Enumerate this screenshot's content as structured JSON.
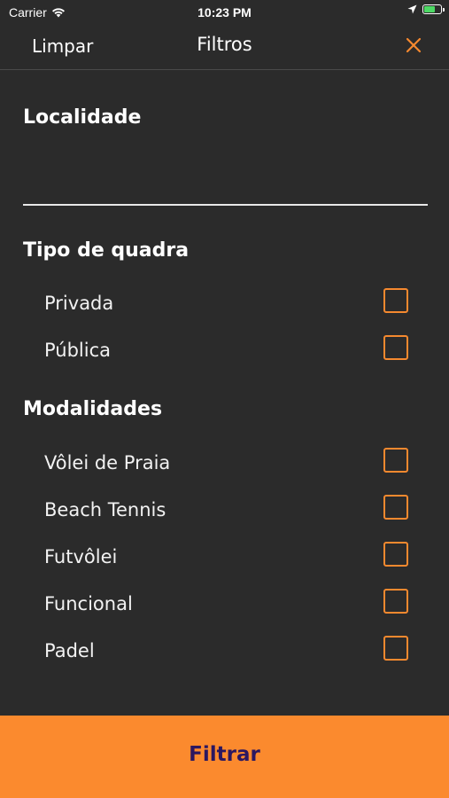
{
  "status_bar": {
    "carrier": "Carrier",
    "time": "10:23 PM"
  },
  "nav": {
    "left_label": "Limpar",
    "title": "Filtros",
    "close_icon": "close-icon",
    "accent_color": "#f5892f"
  },
  "location": {
    "title": "Localidade",
    "value": ""
  },
  "court_type": {
    "title": "Tipo de quadra",
    "options": [
      {
        "label": "Privada",
        "checked": false
      },
      {
        "label": "Pública",
        "checked": false
      }
    ]
  },
  "modalities": {
    "title": "Modalidades",
    "options": [
      {
        "label": "Vôlei de Praia",
        "checked": false
      },
      {
        "label": "Beach Tennis",
        "checked": false
      },
      {
        "label": "Futvôlei",
        "checked": false
      },
      {
        "label": "Funcional",
        "checked": false
      },
      {
        "label": "Padel",
        "checked": false
      }
    ]
  },
  "footer": {
    "button_label": "Filtrar",
    "background": "#fb8a2e",
    "text_color": "#2c1760"
  }
}
